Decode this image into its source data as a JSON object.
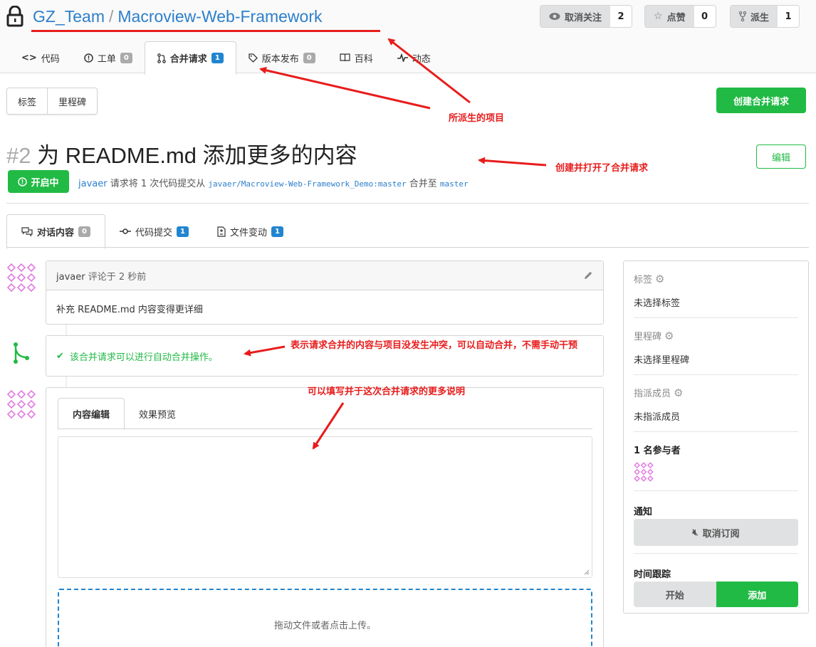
{
  "repo": {
    "owner": "GZ_Team",
    "separator": "/",
    "name": "Macroview-Web-Framework"
  },
  "actions": {
    "watch": {
      "label": "取消关注",
      "count": "2"
    },
    "star": {
      "label": "点赞",
      "count": "0"
    },
    "fork": {
      "label": "派生",
      "count": "1"
    }
  },
  "tabs": [
    {
      "label": "代码",
      "icon": "code-icon"
    },
    {
      "label": "工单",
      "badge": "0",
      "icon": "issue-icon"
    },
    {
      "label": "合并请求",
      "badge": "1",
      "icon": "pull-request-icon"
    },
    {
      "label": "版本发布",
      "badge": "0",
      "icon": "tag-icon"
    },
    {
      "label": "百科",
      "icon": "book-icon"
    },
    {
      "label": "动态",
      "icon": "pulse-icon"
    }
  ],
  "labels_milestones": {
    "labels": "标签",
    "milestones": "里程碑"
  },
  "create_pr_button": "创建合并请求",
  "pr": {
    "number": "#2",
    "title": "为 README.md 添加更多的内容",
    "edit_button": "编辑",
    "status": "开启中",
    "author": "javaer",
    "meta_text_1": "请求将 1 次代码提交从",
    "head_branch": "javaer/Macroview-Web-Framework_Demo:master",
    "meta_text_2": "合并至",
    "base_branch": "master"
  },
  "pr_tabs": [
    {
      "label": "对话内容",
      "badge": "0",
      "icon": "conversation-icon"
    },
    {
      "label": "代码提交",
      "badge": "1",
      "icon": "commit-icon"
    },
    {
      "label": "文件变动",
      "badge": "1",
      "icon": "file-diff-icon"
    }
  ],
  "comment": {
    "author": "javaer",
    "time_text": "评论于 2 秒前",
    "body": "补充 README.md 内容变得更详细"
  },
  "merge_status": "该合并请求可以进行自动合并操作。",
  "editor": {
    "tab_write": "内容编辑",
    "tab_preview": "效果预览",
    "dropzone_text": "拖动文件或者点击上传。"
  },
  "sidebar": {
    "labels_title": "标签",
    "labels_value": "未选择标签",
    "milestone_title": "里程碑",
    "milestone_value": "未选择里程碑",
    "assignees_title": "指派成员",
    "assignees_value": "未指派成员",
    "participants": "1 名参与者",
    "notification_title": "通知",
    "unsubscribe_button": "取消订阅",
    "time_tracking_title": "时间跟踪",
    "start_button": "开始",
    "add_button": "添加"
  },
  "annotations": {
    "forked_project": "所派生的项目",
    "created_pr": "创建并打开了合并请求",
    "no_conflict": "表示请求合并的内容与项目没发生冲突，可以自动合并，不需手动干预",
    "more_description": "可以填写并于这次合并请求的更多说明"
  },
  "colors": {
    "link": "#2c7fcb",
    "green": "#21ba45",
    "blue_badge": "#2185d0",
    "annotation_red": "#e81c1c"
  }
}
